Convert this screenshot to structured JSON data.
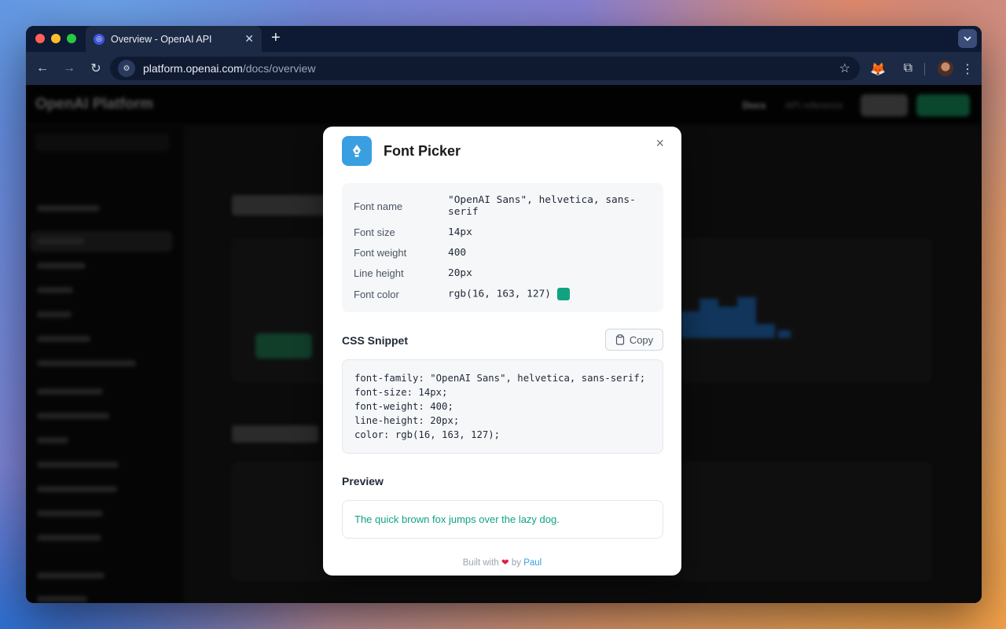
{
  "browser": {
    "tab_title": "Overview - OpenAI API",
    "tab_close": "✕",
    "new_tab": "+",
    "url_host": "platform.openai.com",
    "url_path": "/docs/overview"
  },
  "modal": {
    "title": "Font Picker",
    "close": "×",
    "properties": [
      {
        "label": "Font name",
        "value": "\"OpenAI Sans\", helvetica, sans-serif"
      },
      {
        "label": "Font size",
        "value": "14px"
      },
      {
        "label": "Font weight",
        "value": "400"
      },
      {
        "label": "Line height",
        "value": "20px"
      },
      {
        "label": "Font color",
        "value": "rgb(16, 163, 127)"
      }
    ],
    "swatch_color": "#10a37f",
    "css_snippet_title": "CSS Snippet",
    "copy_label": "Copy",
    "css_snippet": "font-family: \"OpenAI Sans\", helvetica, sans-serif;\nfont-size: 14px;\nfont-weight: 400;\nline-height: 20px;\ncolor: rgb(16, 163, 127);",
    "preview_title": "Preview",
    "preview_text": "The quick brown fox jumps over the lazy dog.",
    "footer_prefix": "Built with",
    "footer_by": "by",
    "footer_author": "Paul"
  },
  "background_page": {
    "logo": "OpenAI Platform",
    "nav_docs": "Docs",
    "nav_api": "API reference"
  }
}
